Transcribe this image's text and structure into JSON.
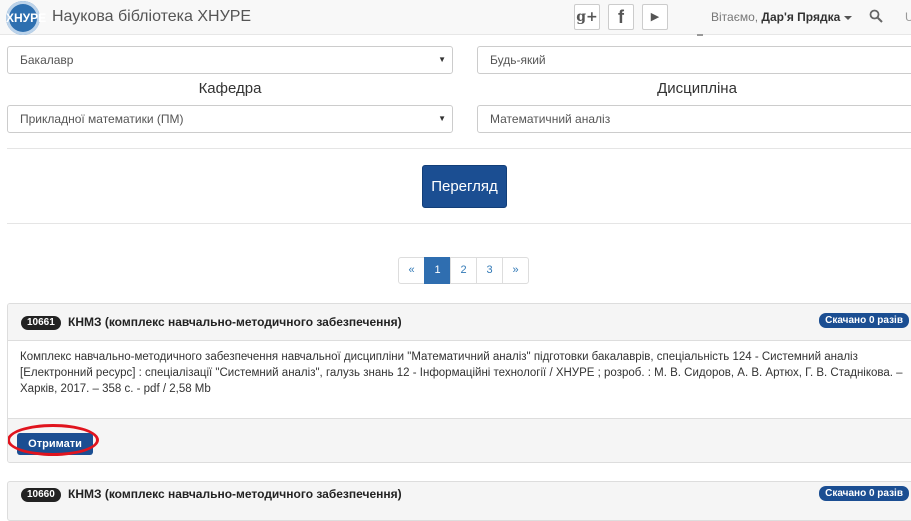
{
  "navbar": {
    "logo_text": "ХНУРЕ",
    "brand": "Наукова бібліотека ХНУРЕ",
    "social": {
      "google": "g+",
      "facebook": "f",
      "youtube": "▶"
    },
    "greeting_prefix": "Вітаємо, ",
    "user_name": "Дар'я Прядка",
    "cut_text": "U"
  },
  "form": {
    "degree_value": "Бакалавр",
    "any_value": "Будь-який",
    "department_label": "Кафедра",
    "department_value": "Прикладної математики (ПМ)",
    "discipline_label": "Дисципліна",
    "discipline_value": "Математичний аналіз",
    "arrow": "▼",
    "view_button": "Перегляд"
  },
  "pagination": {
    "prev": "«",
    "pages": [
      "1",
      "2",
      "3"
    ],
    "next": "»",
    "active": "1"
  },
  "results": [
    {
      "id": "10661",
      "title": "КНМЗ (комплекс навчально-методичного забезпечення)",
      "downloads": "Скачано 0 разів",
      "description": "Комплекс навчально-методичного забезпечення навчальної дисципліни \"Математичний аналіз\" підготовки бакалаврів, спеціальність 124 - Системний аналіз [Електронний ресурс] : спеціалізації \"Системний аналіз\", галузь знань 12 - Інформаційні технології / ХНУРЕ ; розроб. : М. В. Сидоров, А. В. Артюх, Г. В. Стаднікова. – Харків, 2017. – 358 с. - pdf / 2,58 Mb",
      "get_button": "Отримати"
    },
    {
      "id": "10660",
      "title": "КНМЗ (комплекс навчально-методичного забезпечення)",
      "downloads": "Скачано 0 разів"
    }
  ],
  "colors": {
    "primary": "#1b4e92",
    "highlight_ring": "#e0141e"
  }
}
